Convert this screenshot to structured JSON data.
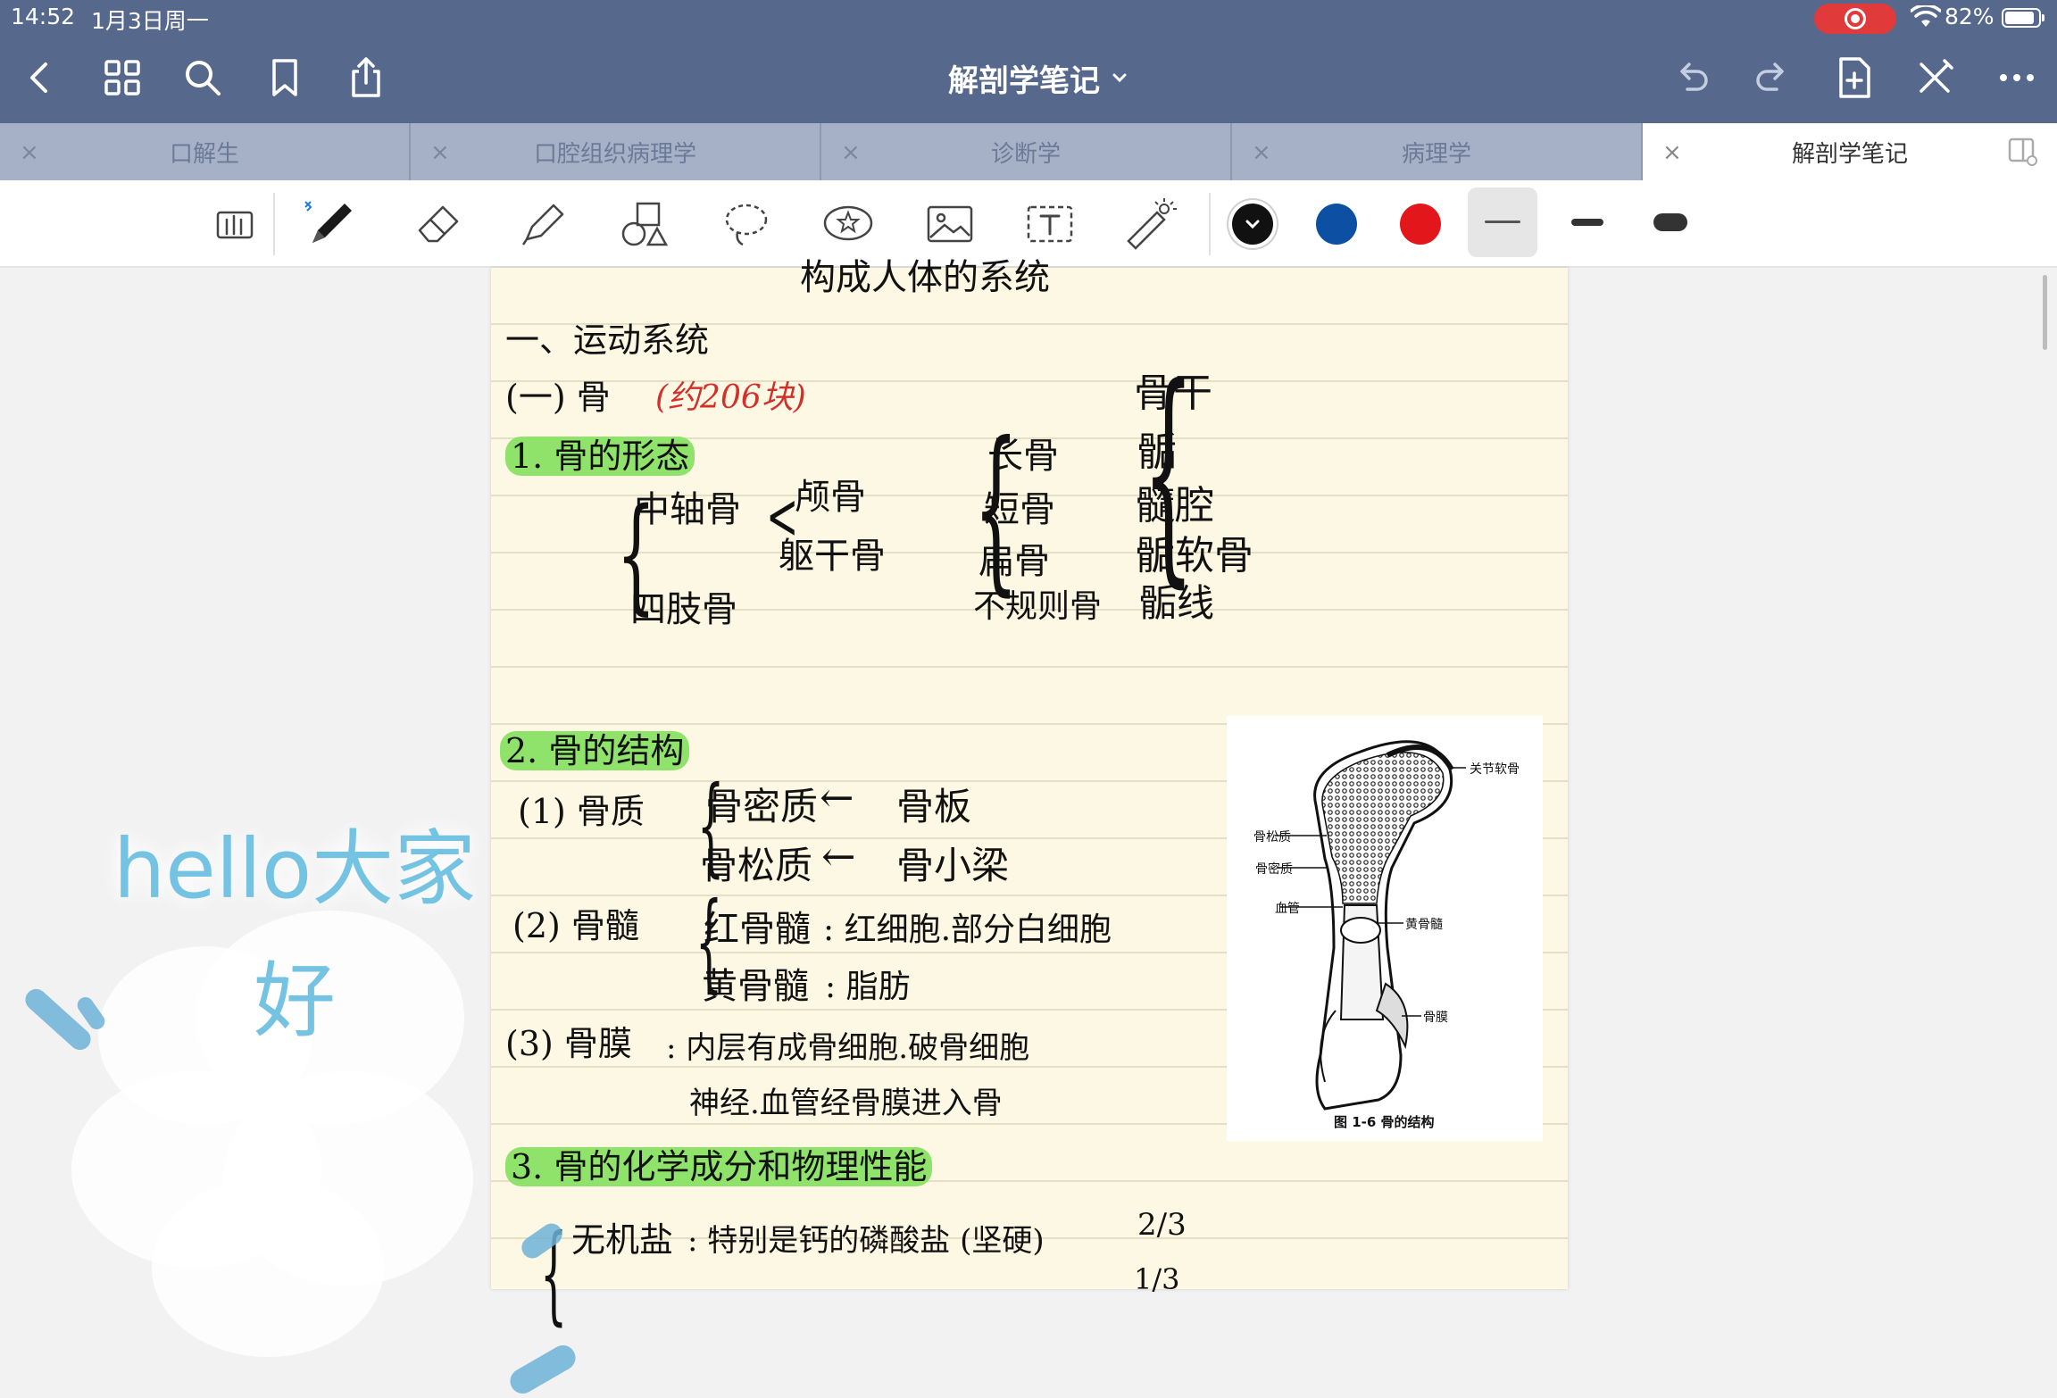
{
  "status": {
    "time": "14:52",
    "date": "1月3日周一",
    "battery": "82%",
    "rec_color": "#e03a3a"
  },
  "header": {
    "title": "解剖学笔记",
    "bg": "#56698c",
    "left_icons": [
      "back-icon",
      "grid-icon",
      "search-icon",
      "bookmark-icon",
      "share-icon"
    ],
    "right_icons": [
      "undo-icon",
      "redo-icon",
      "add-page-icon",
      "close-editing-icon",
      "more-icon"
    ]
  },
  "tabs": [
    {
      "label": "口解生",
      "active": false
    },
    {
      "label": "口腔组织病理学",
      "active": false
    },
    {
      "label": "诊断学",
      "active": false
    },
    {
      "label": "病理学",
      "active": false
    },
    {
      "label": "解剖学笔记",
      "active": true
    }
  ],
  "tab_close_glyph": "×",
  "toolbar": {
    "tools": [
      "hand-mode",
      "pen",
      "eraser",
      "highlighter",
      "shapes",
      "lasso",
      "sticker",
      "image",
      "text",
      "laser-pointer"
    ],
    "colors": [
      "#111111",
      "#0d4fa3",
      "#e3171b"
    ],
    "widths": [
      "thin",
      "medium",
      "thick"
    ]
  },
  "note": {
    "top_cut": "构成人体的系统",
    "sec1": "一、运动系统",
    "sub1": "(一) 骨",
    "sub1_note": "(约206块)",
    "h1": "1. 骨的形态",
    "axial": "中轴骨",
    "skull": "颅骨",
    "trunk": "躯干骨",
    "limb": "四肢骨",
    "long": "长骨",
    "short": "短骨",
    "flat": "扁骨",
    "irregular": "不规则骨",
    "shaft": "骨干",
    "epiphysis": "骺",
    "marrow_cavity": "髓腔",
    "epi_cartilage": "骺软骨",
    "epi_line": "骺线",
    "h2": "2. 骨的结构",
    "p1": "(1) 骨质",
    "compact": "骨密质",
    "arrow1": "←",
    "lamella": "骨板",
    "spongy": "骨松质",
    "arrow2": "←",
    "trabecula": "骨小梁",
    "p2": "(2) 骨髓",
    "red_marrow": "红骨髓",
    "red_marrow_desc": ": 红细胞.部分白细胞",
    "yellow_marrow": "黄骨髓",
    "yellow_marrow_desc": ": 脂肪",
    "p3": "(3) 骨膜",
    "peri_desc1": ": 内层有成骨细胞.破骨细胞",
    "peri_desc2": "神经.血管经骨膜进入骨",
    "h3": "3. 骨的化学成分和物理性能",
    "inorganic": "无机盐",
    "inorganic_desc": ": 特别是钙的磷酸盐 (坚硬)",
    "inorganic_frac": "2/3",
    "organic_frac": "1/3"
  },
  "figure": {
    "caption": "图 1-6  骨的结构",
    "labels": {
      "cartilage": "关节软骨",
      "spongy": "骨松质",
      "compact": "骨密质",
      "vessel": "血管",
      "yellow_marrow": "黄骨髓",
      "periosteum": "骨膜"
    }
  },
  "overlay": {
    "line1": "hello大家",
    "line2": "好",
    "color": "#74c3e3"
  }
}
